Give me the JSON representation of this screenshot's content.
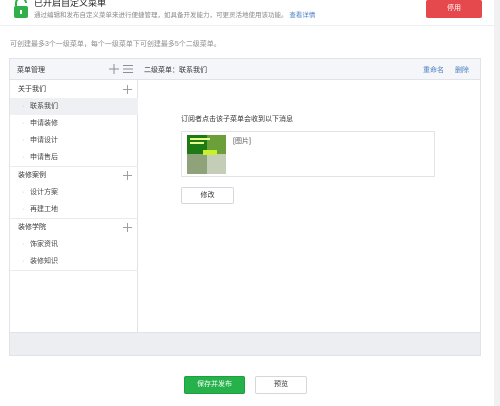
{
  "notice": {
    "title": "已开启自定义菜单",
    "description": "通过编辑和发布自定义菜单来进行便捷管理，如具备开发能力，可更灵活地使用该功能。",
    "link": "查看详情",
    "disable_label": "停用"
  },
  "intro": "可创建最多3个一级菜单，每个一级菜单下可创建最多5个二级菜单。",
  "sidebar": {
    "title": "菜单管理",
    "groups": [
      {
        "title": "关于我们",
        "items": [
          "联系我们",
          "申请装修",
          "申请设计",
          "申请售后"
        ]
      },
      {
        "title": "装修案例",
        "items": [
          "设计方案",
          "再建工地"
        ]
      },
      {
        "title": "装修学院",
        "items": [
          "饰家资讯",
          "装修知识"
        ]
      }
    ]
  },
  "main": {
    "title": "二级菜单：联系我们",
    "rename": "重命名",
    "delete": "删除",
    "message_label": "订阅者点击该子菜单会收到以下消息",
    "image_tag": "[图片]",
    "edit_label": "修改"
  },
  "footer": {
    "publish_label": "保存并发布",
    "preview_label": "预览"
  },
  "colors": {
    "primary_green": "#26b24b",
    "danger_red": "#e5484d",
    "link_blue": "#4a7fc1"
  }
}
